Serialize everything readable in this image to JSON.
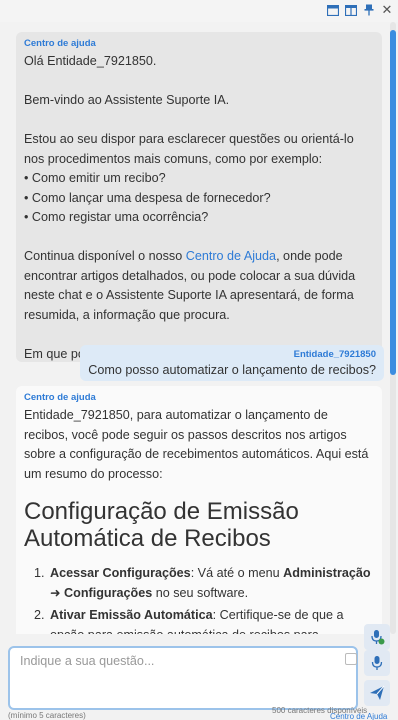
{
  "topbar": {
    "icons": [
      "window-icon",
      "split-view-icon",
      "pin-icon",
      "close-icon"
    ],
    "close_glyph": "✕"
  },
  "messages": {
    "welcome": {
      "sender": "Centro de ajuda",
      "greeting": "Olá Entidade_7921850.",
      "welcome": "Bem-vindo ao Assistente Suporte IA.",
      "intro": "Estou ao seu dispor para esclarecer questões ou orientá-lo nos procedimentos mais comuns, como por exemplo:",
      "examples": [
        "• Como emitir um recibo?",
        "• Como lançar uma despesa de fornecedor?",
        "• Como registar uma ocorrência?"
      ],
      "help_pre": "Continua disponível o nosso ",
      "help_link": "Centro de Ajuda",
      "help_post": ", onde pode encontrar artigos detalhados, ou pode colocar a sua dúvida neste chat e o Assistente Suporte IA apresentará, de forma resumida, a informação que procura.",
      "question": "Em que posso ajudar?"
    },
    "user": {
      "sender": "Entidade_7921850",
      "text": "Como posso automatizar o lançamento de recibos?"
    },
    "answer": {
      "sender": "Centro de ajuda",
      "intro": "Entidade_7921850, para automatizar o lançamento de recibos, você pode seguir os passos descritos nos artigos sobre a configuração de recebimentos automáticos. Aqui está um resumo do processo:",
      "article_title": "Configuração de Emissão Automática de Recibos",
      "steps": [
        {
          "title": "Acessar Configurações",
          "sep": ": Vá até o menu ",
          "bold1": "Administração ➜ Configurações",
          "rest": " no seu software."
        },
        {
          "title": "Ativar Emissão Automática",
          "sep": ": Certifique-se de que a opção para emissão automática de recibos para recebimentos automáticos está ativada. Isso permitirá",
          "bold1": "",
          "rest": ""
        }
      ]
    }
  },
  "input": {
    "placeholder": "Indique a sua questão...",
    "chars_left": "500 caracteres disponíveis",
    "min_hint": "(mínimo 5 caracteres)",
    "help_link": "Centro de Ajuda"
  }
}
